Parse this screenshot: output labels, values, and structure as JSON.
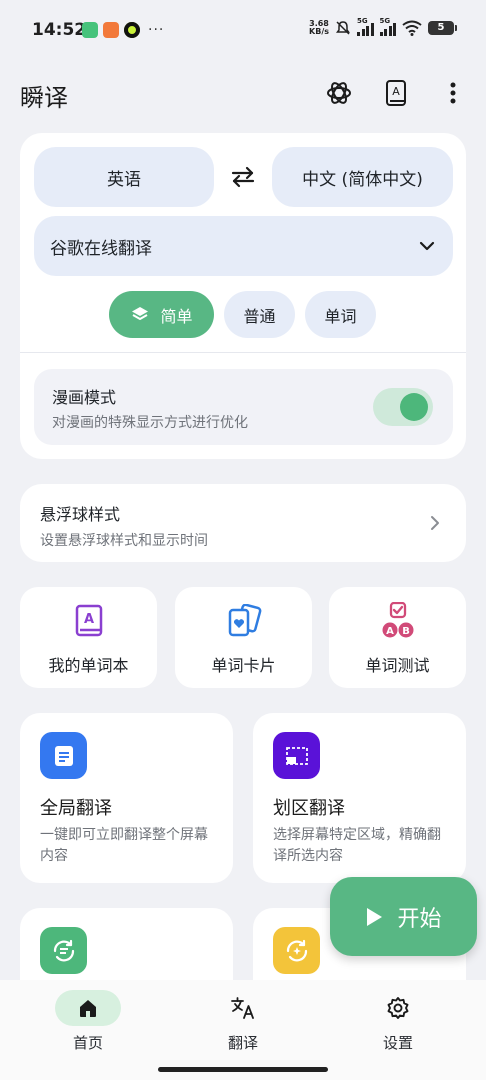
{
  "status_bar": {
    "time": "14:52",
    "more_indicator": "···",
    "net_speed_value": "3.68",
    "net_speed_unit": "KB/s",
    "signal_1_label": "5G",
    "signal_2_label": "5G",
    "battery_level": "5"
  },
  "app_bar": {
    "title": "瞬译",
    "icons": [
      "openai-icon",
      "dictionary-icon",
      "more-vert-icon"
    ]
  },
  "translation_card": {
    "source_language": "英语",
    "target_language": "中文 (简体中文)",
    "engine": "谷歌在线翻译",
    "modes": [
      {
        "label": "简单",
        "active": true
      },
      {
        "label": "普通",
        "active": false
      },
      {
        "label": "单词",
        "active": false
      }
    ],
    "manga_mode": {
      "title": "漫画模式",
      "subtitle": "对漫画的特殊显示方式进行优化",
      "enabled": true
    }
  },
  "float_ball": {
    "title": "悬浮球样式",
    "subtitle": "设置悬浮球样式和显示时间"
  },
  "word_tools": [
    {
      "label": "我的单词本",
      "icon": "wordbook-icon",
      "color": "#8a3fd0"
    },
    {
      "label": "单词卡片",
      "icon": "flashcard-icon",
      "color": "#2f7de1"
    },
    {
      "label": "单词测试",
      "icon": "quiz-icon",
      "color": "#d14a78"
    }
  ],
  "features": [
    {
      "title": "全局翻译",
      "desc": "一键即可立即翻译整个屏幕内容",
      "icon": "document-icon",
      "color": "#3478f0"
    },
    {
      "title": "划区翻译",
      "desc": "选择屏幕特定区域，精确翻译所选内容",
      "icon": "region-select-icon",
      "color": "#5a12d8"
    },
    {
      "title": "",
      "desc": "",
      "icon": "auto-translate-icon",
      "color": "#4db77b"
    },
    {
      "title": "",
      "desc": "",
      "icon": "refresh-icon",
      "color": "#f3c43a"
    }
  ],
  "fab": {
    "label": "开始"
  },
  "bottom_nav": [
    {
      "label": "首页",
      "icon": "home-icon",
      "active": true
    },
    {
      "label": "翻译",
      "icon": "translate-icon",
      "active": false
    },
    {
      "label": "设置",
      "icon": "settings-icon",
      "active": false
    }
  ]
}
